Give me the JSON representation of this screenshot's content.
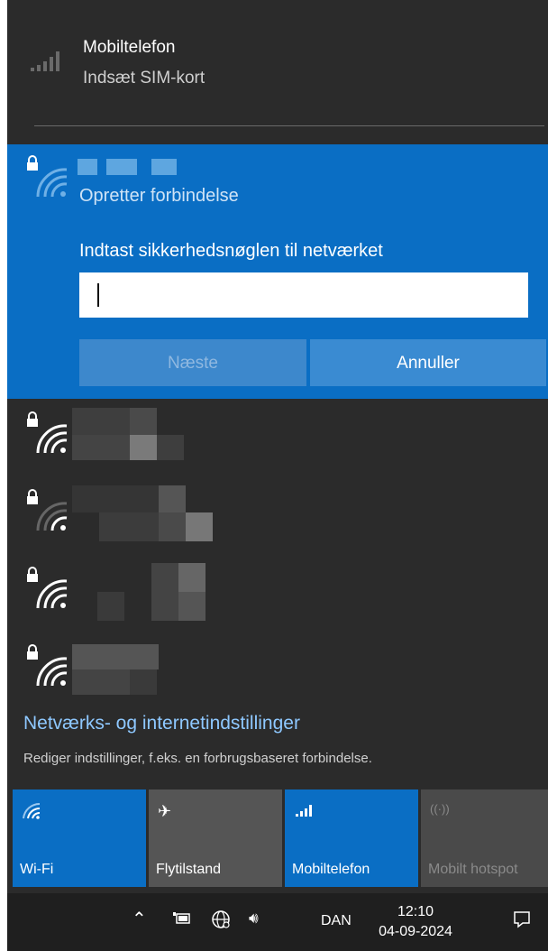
{
  "cellular": {
    "title": "Mobiltelefon",
    "subtitle": "Indsæt SIM-kort",
    "icon": "signal-bars-icon"
  },
  "expanded_network": {
    "status": "Opretter forbindelse",
    "prompt": "Indtast sikkerhedsnøglen til netværket",
    "key_value": "",
    "next_label": "Næste",
    "cancel_label": "Annuller",
    "accent": "#0a6ec4"
  },
  "networks": [
    {
      "icon": "secured-wifi-icon",
      "signal": "strong"
    },
    {
      "icon": "secured-wifi-icon",
      "signal": "weak"
    },
    {
      "icon": "secured-wifi-icon",
      "signal": "strong"
    },
    {
      "icon": "secured-wifi-icon",
      "signal": "strong"
    }
  ],
  "settings": {
    "title": "Netværks- og internetindstillinger",
    "subtitle": "Rediger indstillinger, f.eks. en forbrugsbaseret forbindelse.",
    "link_color": "#8ec8ff"
  },
  "quick_actions": [
    {
      "label": "Wi-Fi",
      "icon": "wifi-icon",
      "active": true
    },
    {
      "label": "Flytilstand",
      "icon": "airplane-icon",
      "active": false
    },
    {
      "label": "Mobiltelefon",
      "icon": "signal-bars-icon",
      "active": true
    },
    {
      "label": "Mobilt hotspot",
      "icon": "hotspot-icon",
      "active": false,
      "disabled": true
    }
  ],
  "taskbar": {
    "language": "DAN",
    "time": "12:10",
    "date": "04-09-2024"
  }
}
